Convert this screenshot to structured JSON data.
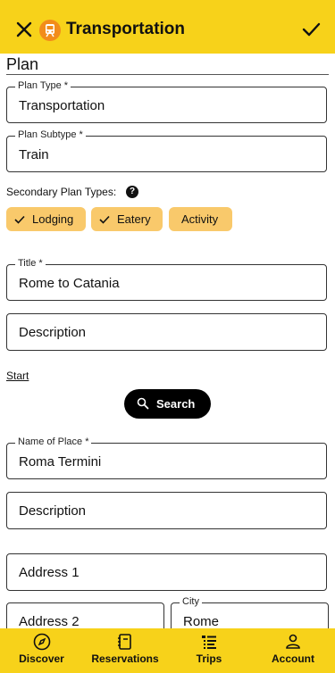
{
  "header": {
    "title": "Transportation",
    "close_icon": "close-icon",
    "confirm_icon": "check-icon",
    "category_icon": "train-icon",
    "badge_color": "#f28c1a",
    "bar_color": "#f7d21a"
  },
  "section": {
    "title": "Plan"
  },
  "plan_type": {
    "label": "Plan Type *",
    "value": "Transportation"
  },
  "plan_subtype": {
    "label": "Plan Subtype *",
    "value": "Train"
  },
  "secondary": {
    "label": "Secondary Plan Types:",
    "help_icon": "help-icon",
    "chips": [
      {
        "label": "Lodging",
        "selected": true
      },
      {
        "label": "Eatery",
        "selected": true
      },
      {
        "label": "Activity",
        "selected": false
      }
    ]
  },
  "title_field": {
    "label": "Title *",
    "value": "Rome to Catania"
  },
  "description1": {
    "placeholder": "Description"
  },
  "start": {
    "link": "Start",
    "search_label": "Search",
    "place_label": "Name of Place *",
    "place_value": "Roma Termini",
    "description_placeholder": "Description",
    "address1_placeholder": "Address 1",
    "address2_placeholder": "Address 2",
    "city_label": "City",
    "city_value": "Rome"
  },
  "nav": [
    {
      "label": "Discover",
      "icon": "compass-icon"
    },
    {
      "label": "Reservations",
      "icon": "notebook-icon"
    },
    {
      "label": "Trips",
      "icon": "list-icon"
    },
    {
      "label": "Account",
      "icon": "person-icon"
    }
  ]
}
